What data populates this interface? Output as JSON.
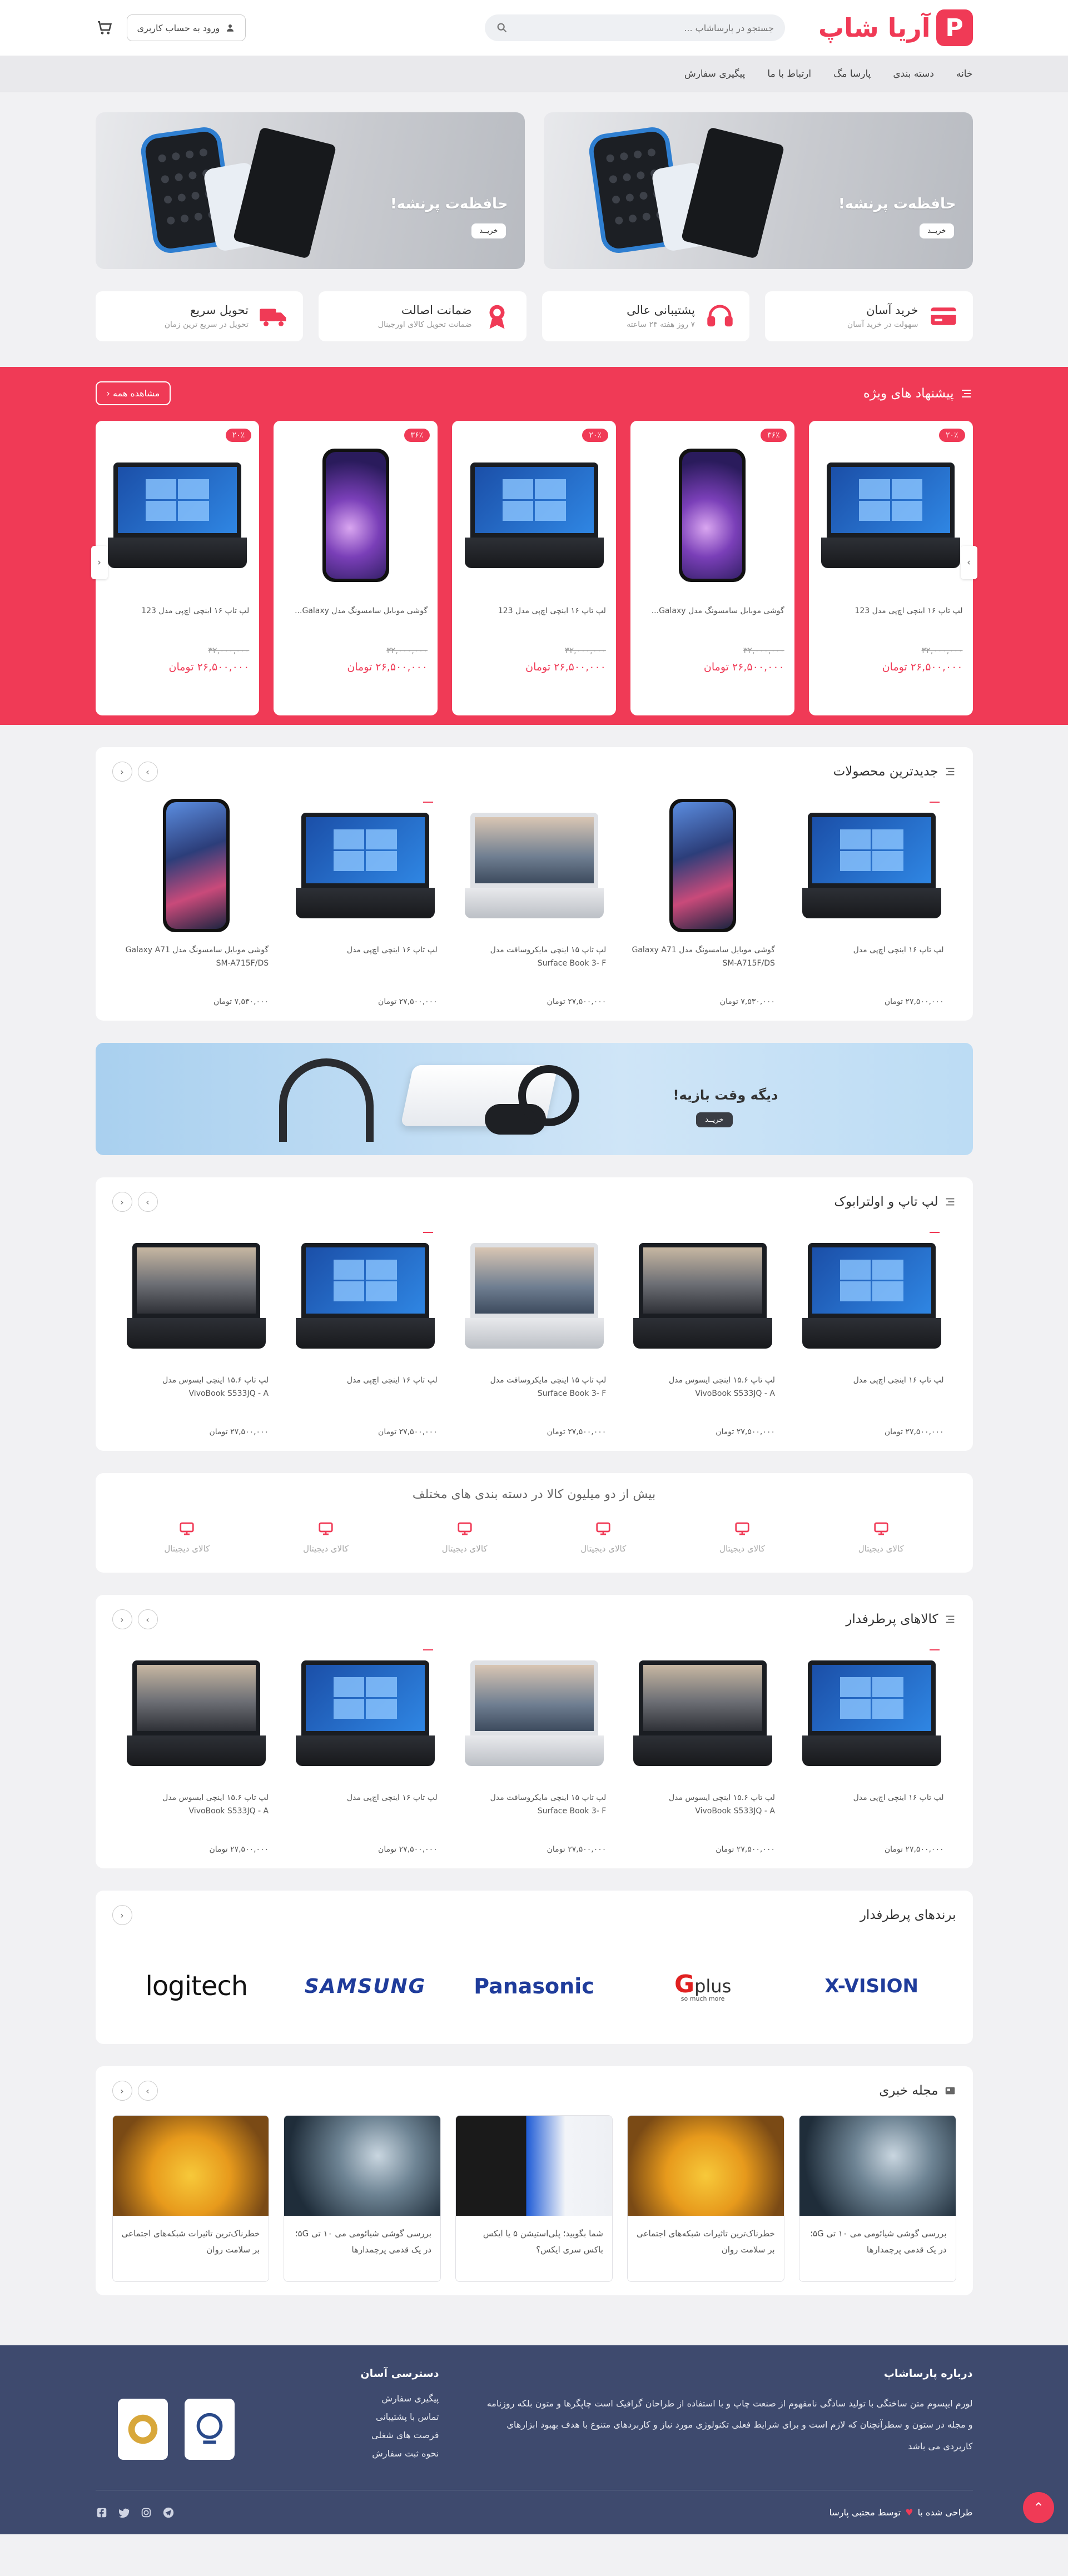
{
  "header": {
    "logo_mark": "P",
    "logo_text": "آریا شاپ",
    "search_placeholder": "جستجو در پارساشاپ ...",
    "login_label": "ورود به حساب کاربری"
  },
  "nav": [
    "خانه",
    "دسته بندی",
    "پارسا مگ",
    "ارتباط با ما",
    "پیگیری سفارش"
  ],
  "banners": [
    {
      "title": "حافظه‌ت پرنشه!",
      "button": "خریــد"
    },
    {
      "title": "حافظه‌ت پرنشه!",
      "button": "خریــد"
    }
  ],
  "features": [
    {
      "title": "خرید آسان",
      "sub": "سهولت در خرید آسان",
      "icon": "card-icon"
    },
    {
      "title": "پشتیبانی عالی",
      "sub": "۷ روز هفته ۲۴ ساعته",
      "icon": "headset-icon"
    },
    {
      "title": "ضمانت اصالت",
      "sub": "ضمانت تحویل کالای اورجینال",
      "icon": "medal-icon"
    },
    {
      "title": "تحویل سریع",
      "sub": "تحویل در سریع ترین زمان",
      "icon": "truck-icon"
    }
  ],
  "offers": {
    "title": "پیشنهاد های ویژه",
    "see_all": "مشاهده همه",
    "items": [
      {
        "kind": "laptop",
        "discount": "۲۰٪",
        "name": "لپ تاپ ۱۶ اینچی اچ‌پی مدل 123",
        "old": "۳۲,۰۰۰,۰۰۰",
        "price": "۲۶,۵۰۰,۰۰۰ تومان"
      },
      {
        "kind": "phone",
        "discount": "۳۶٪",
        "name": "گوشی موبایل سامسونگ مدل Galaxy...",
        "old": "۳۲,۰۰۰,۰۰۰",
        "price": "۲۶,۵۰۰,۰۰۰ تومان"
      },
      {
        "kind": "laptop",
        "discount": "۲۰٪",
        "name": "لپ تاپ ۱۶ اینچی اچ‌پی مدل 123",
        "old": "۳۲,۰۰۰,۰۰۰",
        "price": "۲۶,۵۰۰,۰۰۰ تومان"
      },
      {
        "kind": "phone",
        "discount": "۳۶٪",
        "name": "گوشی موبایل سامسونگ مدل Galaxy...",
        "old": "۳۲,۰۰۰,۰۰۰",
        "price": "۲۶,۵۰۰,۰۰۰ تومان"
      },
      {
        "kind": "laptop",
        "discount": "۲۰٪",
        "name": "لپ تاپ ۱۶ اینچی اچ‌پی مدل 123",
        "old": "۳۲,۰۰۰,۰۰۰",
        "price": "۲۶,۵۰۰,۰۰۰ تومان"
      }
    ]
  },
  "newest": {
    "title": "جدیدترین محصولات",
    "items": [
      {
        "kind": "laptop",
        "name": "لپ تاپ ۱۶ اینچی اچ‌پی مدل",
        "price": "۲۷,۵۰۰,۰۰۰ تومان"
      },
      {
        "kind": "phone-a71",
        "name": "گوشی موبایل سامسونگ مدل Galaxy A71 SM-A715F/DS",
        "price": "۷,۵۳۰,۰۰۰ تومان"
      },
      {
        "kind": "surface",
        "name": "لپ تاپ ۱۵ اینچی مایکروسافت مدل Surface Book 3- F",
        "price": "۲۷,۵۰۰,۰۰۰ تومان"
      },
      {
        "kind": "laptop",
        "name": "لپ تاپ ۱۶ اینچی اچ‌پی مدل",
        "price": "۲۷,۵۰۰,۰۰۰ تومان"
      },
      {
        "kind": "phone-a71",
        "name": "گوشی موبایل سامسونگ مدل Galaxy A71 SM-A715F/DS",
        "price": "۷,۵۳۰,۰۰۰ تومان"
      }
    ]
  },
  "wide_banner": {
    "title": "دیگه وقت بازیه!",
    "button": "خریــد"
  },
  "laptops": {
    "title": "لپ تاپ و اولترابوک",
    "items": [
      {
        "kind": "laptop",
        "name": "لپ تاپ ۱۶ اینچی اچ‌پی مدل",
        "price": "۲۷,۵۰۰,۰۰۰ تومان"
      },
      {
        "kind": "asus",
        "name": "لپ تاپ ۱۵.۶ اینچی ایسوس مدل VivoBook S533JQ - A",
        "price": "۲۷,۵۰۰,۰۰۰ تومان"
      },
      {
        "kind": "surface",
        "name": "لپ تاپ ۱۵ اینچی مایکروسافت مدل Surface Book 3- F",
        "price": "۲۷,۵۰۰,۰۰۰ تومان"
      },
      {
        "kind": "laptop",
        "name": "لپ تاپ ۱۶ اینچی اچ‌پی مدل",
        "price": "۲۷,۵۰۰,۰۰۰ تومان"
      },
      {
        "kind": "asus",
        "name": "لپ تاپ ۱۵.۶ اینچی ایسوس مدل VivoBook S533JQ - A",
        "price": "۲۷,۵۰۰,۰۰۰ تومان"
      }
    ]
  },
  "categories": {
    "title": "بیش از دو میلیون کالا در دسته بندی های مختلف",
    "items": [
      "کالای دیجیتال",
      "کالای دیجیتال",
      "کالای دیجیتال",
      "کالای دیجیتال",
      "کالای دیجیتال",
      "کالای دیجیتال"
    ]
  },
  "bestsellers": {
    "title": "کالاهای پرطرفدار",
    "items": [
      {
        "kind": "laptop",
        "name": "لپ تاپ ۱۶ اینچی اچ‌پی مدل",
        "price": "۲۷,۵۰۰,۰۰۰ تومان"
      },
      {
        "kind": "asus",
        "name": "لپ تاپ ۱۵.۶ اینچی ایسوس مدل VivoBook S533JQ - A",
        "price": "۲۷,۵۰۰,۰۰۰ تومان"
      },
      {
        "kind": "surface",
        "name": "لپ تاپ ۱۵ اینچی مایکروسافت مدل Surface Book 3- F",
        "price": "۲۷,۵۰۰,۰۰۰ تومان"
      },
      {
        "kind": "laptop",
        "name": "لپ تاپ ۱۶ اینچی اچ‌پی مدل",
        "price": "۲۷,۵۰۰,۰۰۰ تومان"
      },
      {
        "kind": "asus",
        "name": "لپ تاپ ۱۵.۶ اینچی ایسوس مدل VivoBook S533JQ - A",
        "price": "۲۷,۵۰۰,۰۰۰ تومان"
      }
    ]
  },
  "brands": {
    "title": "برندهای پرطرفدار",
    "logos": [
      "X-VISION",
      "plus",
      "Panasonic",
      "SAMSUNG",
      "logitech"
    ],
    "gplus_tag": "so much more"
  },
  "blog": {
    "title": "مجله خبری",
    "posts": [
      {
        "thumb": "robot",
        "text": "بررسی گوشی شیائومی می ۱۰ تی ۵G؛ در یک قدمی پرچمدارها"
      },
      {
        "thumb": "gold",
        "text": "خطرناک‌ترین تاثیرات شبکه‌های اجتماعی بر سلامت روان"
      },
      {
        "thumb": "xbox",
        "text": "شما بگویید؛ پلی‌استیشن ۵ یا ایکس باکس سری ایکس؟"
      },
      {
        "thumb": "robot",
        "text": "بررسی گوشی شیائومی می ۱۰ تی ۵G؛ در یک قدمی پرچمدارها"
      },
      {
        "thumb": "gold",
        "text": "خطرناک‌ترین تاثیرات شبکه‌های اجتماعی بر سلامت روان"
      }
    ]
  },
  "footer": {
    "about_title": "درباره پارساشاپ",
    "about_text": "لورم ایپسوم متن ساختگی با تولید سادگی نامفهوم از صنعت چاپ و با استفاده از طراحان گرافیک است چاپگرها و متون بلکه روزنامه و مجله در ستون و سطرآنچنان که لازم است و برای شرایط فعلی تکنولوژی مورد نیاز و کاربردهای متنوع با هدف بهبود ابزارهای کاربردی می باشد",
    "links_title": "دسترسی آسان",
    "links": [
      "پیگیری سفارش",
      "تماس با پشتیبانی",
      "فرصت های شغلی",
      "نحوه ثبت سفارش"
    ],
    "credit_prefix": "طراحی شده با",
    "credit_suffix": "توسط مجتبی پارسا"
  },
  "colors": {
    "accent": "#f03a56",
    "footer": "#3e4a6e"
  }
}
